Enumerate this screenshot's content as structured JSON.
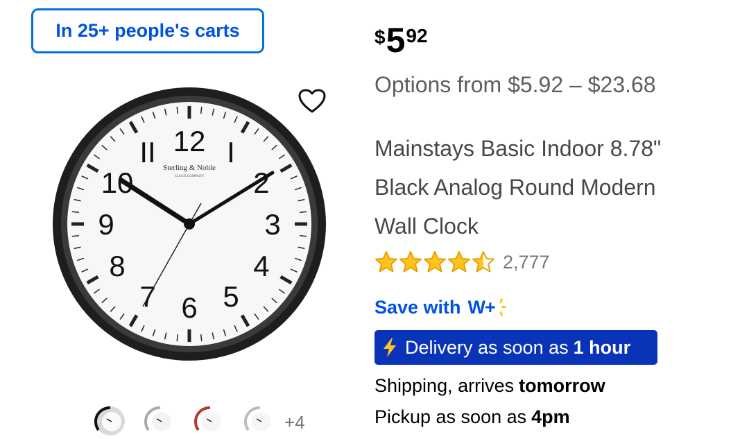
{
  "badge": {
    "text": "In 25+ people's carts"
  },
  "price": {
    "currency": "$",
    "whole": "5",
    "cents": "92"
  },
  "options": {
    "text": "Options from $5.92 – $23.68"
  },
  "product": {
    "title_lines": [
      "Mainstays Basic Indoor 8.78\"",
      "Black Analog Round Modern",
      "Wall Clock"
    ],
    "image_brand": "Sterling & Noble",
    "image_brand_sub": "CLOCK COMPANY"
  },
  "rating": {
    "stars": 4.5,
    "max": 5,
    "count": "2,777",
    "star_color": "#ffc220"
  },
  "save_with": {
    "label": "Save with",
    "program": "W+"
  },
  "delivery": {
    "prefix": "Delivery as soon as",
    "time": "1 hour",
    "bg": "#0a34b7"
  },
  "shipping": {
    "prefix": "Shipping, arrives",
    "when": "tomorrow"
  },
  "pickup": {
    "prefix": "Pickup as soon as",
    "when": "4pm"
  },
  "thumbnails": {
    "count": 4,
    "more": "+4",
    "variants": [
      "black",
      "white",
      "red",
      "silver"
    ]
  },
  "icons": {
    "favorite": "heart-outline-icon",
    "delivery": "lightning-bolt-icon",
    "rating": "star-icon"
  },
  "colors": {
    "accent": "#0053e2",
    "banner": "#0a34b7",
    "star": "#ffc220",
    "spark": "#ffc220"
  }
}
